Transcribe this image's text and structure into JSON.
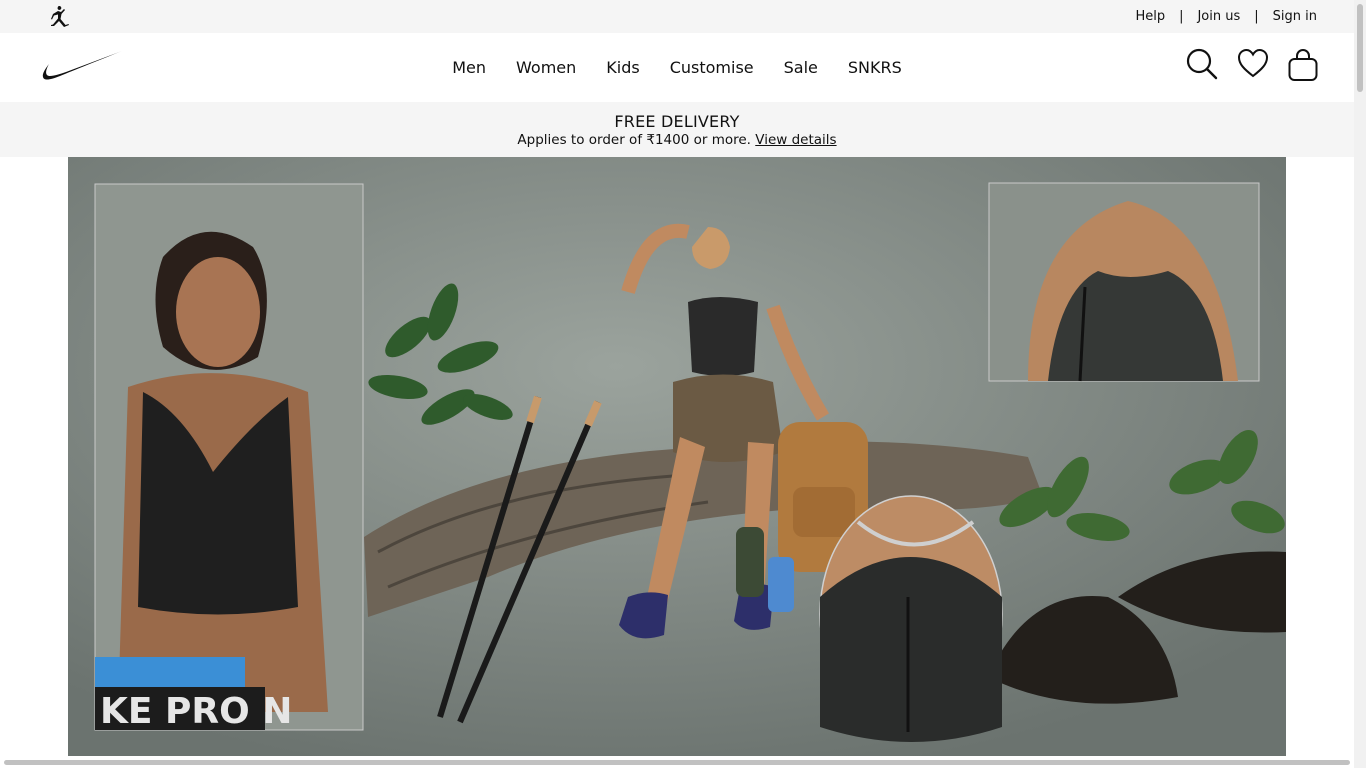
{
  "utility_bar": {
    "links": {
      "help": "Help",
      "join": "Join us",
      "sign_in": "Sign in"
    },
    "separator": "|"
  },
  "nav": {
    "items": [
      "Men",
      "Women",
      "Kids",
      "Customise",
      "Sale",
      "SNKRS"
    ]
  },
  "icons": {
    "brand_logo": "swoosh-icon",
    "jordan_logo": "jumpman-icon",
    "search": "search-icon",
    "favourites": "heart-icon",
    "bag": "bag-icon"
  },
  "promo": {
    "title": "FREE DELIVERY",
    "subtitle": "Applies to order of ₹1400 or more.",
    "link": "View details"
  },
  "hero": {
    "waistband_text": "KE PRO N"
  },
  "colors": {
    "utility_bg": "#f5f5f5",
    "text": "#111111",
    "hero_bg": "#838b85"
  }
}
